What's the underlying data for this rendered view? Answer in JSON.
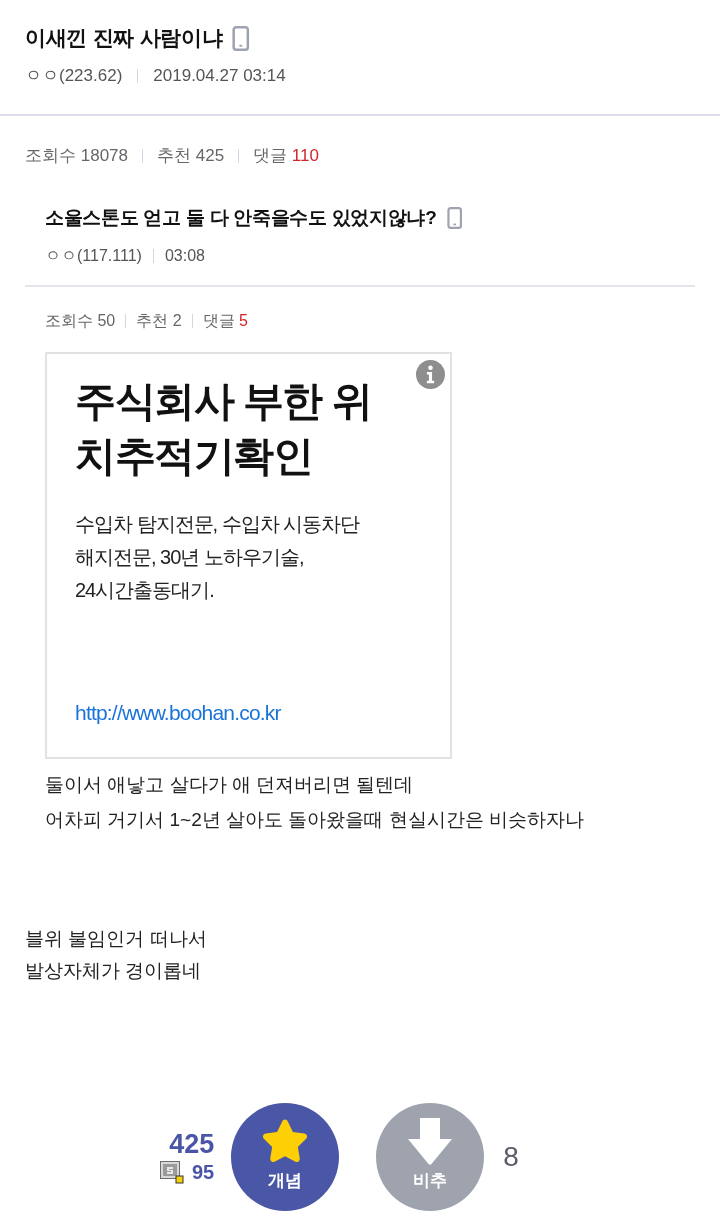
{
  "post": {
    "title": "이새낀 진짜 사람이냐",
    "mobile": true,
    "author": "ㅇㅇ(223.62)",
    "date": "2019.04.27 03:14"
  },
  "stats": [
    {
      "kind": "views",
      "label": "조회수",
      "value": "18078"
    },
    {
      "kind": "recommends",
      "label": "추천",
      "value": "425"
    },
    {
      "kind": "comments",
      "label": "댓글",
      "value": "110"
    }
  ],
  "quoted_post": {
    "title": "소울스톤도 얻고 둘 다 안죽을수도 있었지않냐?",
    "mobile": true,
    "author": "ㅇㅇ(117.111)",
    "time": "03:08",
    "stats": [
      {
        "kind": "views",
        "label": "조회수",
        "value": "50"
      },
      {
        "kind": "recommends",
        "label": "추천",
        "value": "2"
      },
      {
        "kind": "comments",
        "label": "댓글",
        "value": "5"
      }
    ],
    "ad": {
      "headline_lines": [
        "주식회사 부한 위",
        "치추적기확인"
      ],
      "description_lines": [
        "수입차 탐지전문, 수입차 시동차단",
        "해지전문, 30년 노하우기술,",
        "24시간출동대기."
      ],
      "link": "http://www.boohan.co.kr"
    },
    "body_lines": [
      "둘이서 애낳고 살다가 애 던져버리면 될텐데",
      "어차피 거기서 1~2년 살아도 돌아왔을때 현실시간은 비슷하자나"
    ]
  },
  "body_lines": [
    "블위 불임인거 떠나서",
    "발상자체가 경이롭네"
  ],
  "vote": {
    "up_count": "425",
    "fixed_up_count": "95",
    "up_label": "개념",
    "down_label": "비추",
    "down_count": "8"
  }
}
